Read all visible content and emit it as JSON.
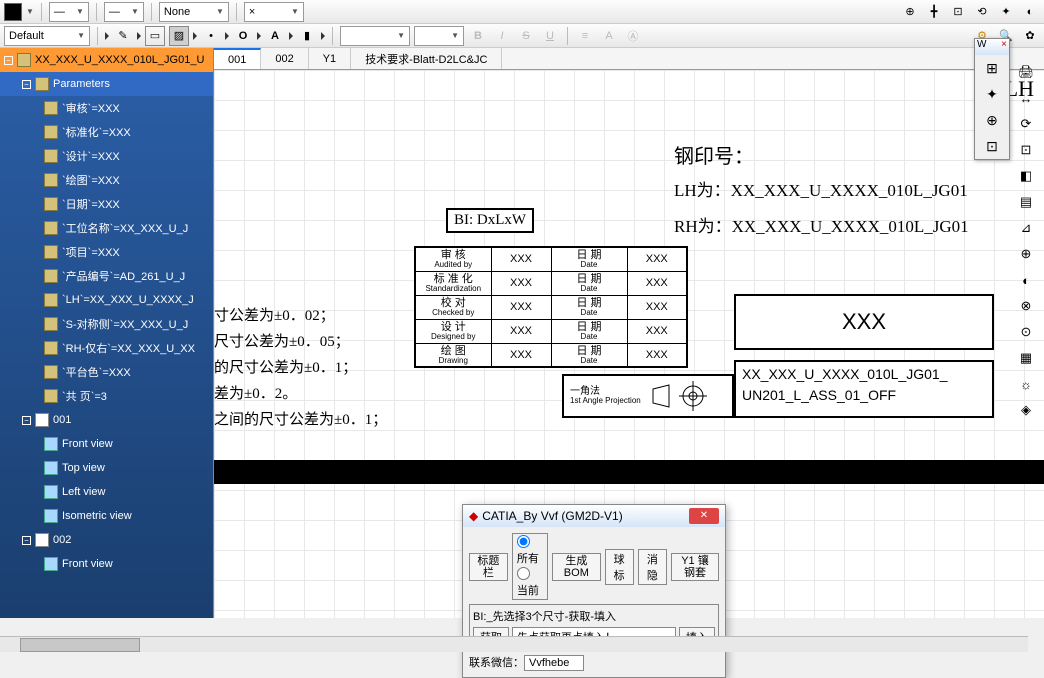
{
  "toolbar": {
    "none_label": "None",
    "default_label": "Default",
    "letter_o": "O",
    "letter_a": "A"
  },
  "tree": {
    "root": "XX_XXX_U_XXXX_010L_JG01_U",
    "params_label": "Parameters",
    "items": [
      "`审核`=XXX",
      "`标准化`=XXX",
      "`设计`=XXX",
      "`绘图`=XXX",
      "`日期`=XXX",
      "`工位名称`=XX_XXX_U_J",
      "`项目`=XXX",
      "`产品编号`=AD_261_U_J",
      "`LH`=XX_XXX_U_XXXX_J",
      "`S-对称侧`=XX_XXX_U_J",
      "`RH-仅右`=XX_XXX_U_XX",
      "`平台色`=XXX",
      "`共 页`=3"
    ],
    "sheet1": "001",
    "views": [
      "Front view",
      "Top view",
      "Left view",
      "Isometric view"
    ],
    "sheet2": "002",
    "view2": "Front view"
  },
  "tabs": [
    "001",
    "002",
    "Y1",
    "技术要求-Blatt-D2LC&JC"
  ],
  "notes": {
    "ltr": "LH",
    "stamp": "钢印号：",
    "lh": "LH为：XX_XXX_U_XXXX_010L_JG01",
    "rh": "RH为：XX_XXX_U_XXXX_010L_JG01",
    "bi": "BI: DxLxW",
    "tol1": "寸公差为±0．02；",
    "tol2": "尺寸公差为±0．05；",
    "tol3": "的尺寸公差为±0．1；",
    "tol4": "差为±0．2。",
    "tol5": "之间的尺寸公差为±0．1；"
  },
  "titleblock": {
    "rows": [
      {
        "zh": "审    核",
        "en": "Audited by",
        "v1": "XXX",
        "zh2": "日    期",
        "en2": "Date",
        "v2": "XXX"
      },
      {
        "zh": "标  准  化",
        "en": "Standardization",
        "v1": "XXX",
        "zh2": "日    期",
        "en2": "Date",
        "v2": "XXX"
      },
      {
        "zh": "校    对",
        "en": "Checked by",
        "v1": "XXX",
        "zh2": "日    期",
        "en2": "Date",
        "v2": "XXX"
      },
      {
        "zh": "设    计",
        "en": "Designed by",
        "v1": "XXX",
        "zh2": "日    期",
        "en2": "Date",
        "v2": "XXX"
      },
      {
        "zh": "绘    图",
        "en": "Drawing",
        "v1": "XXX",
        "zh2": "日    期",
        "en2": "Date",
        "v2": "XXX"
      }
    ],
    "big": "XXX",
    "proj_zh": "一角法",
    "proj_en": "1st Angle\nProjection",
    "partno": "XX_XXX_U_XXXX_010L_JG01_",
    "assy": "UN201_L_ASS_01_OFF"
  },
  "dialog": {
    "title": "CATIA_By Vvf (GM2D-V1)",
    "btn_title": "标题\n栏",
    "radio_all": "所有",
    "radio_cur": "当前",
    "btn_bom": "生成\nBOM",
    "btn_ball": "球标",
    "btn_hide": "消隐",
    "btn_y1": "Y1\n镶钢套",
    "hint": "BI:_先选择3个尺寸-获取-填入",
    "btn_get": "获取",
    "field_val": "先点获取再点填入！",
    "btn_fill": "填入",
    "contact": "联系微信：",
    "contact_val": "Vvfhebe"
  },
  "float": {
    "title": "W"
  }
}
